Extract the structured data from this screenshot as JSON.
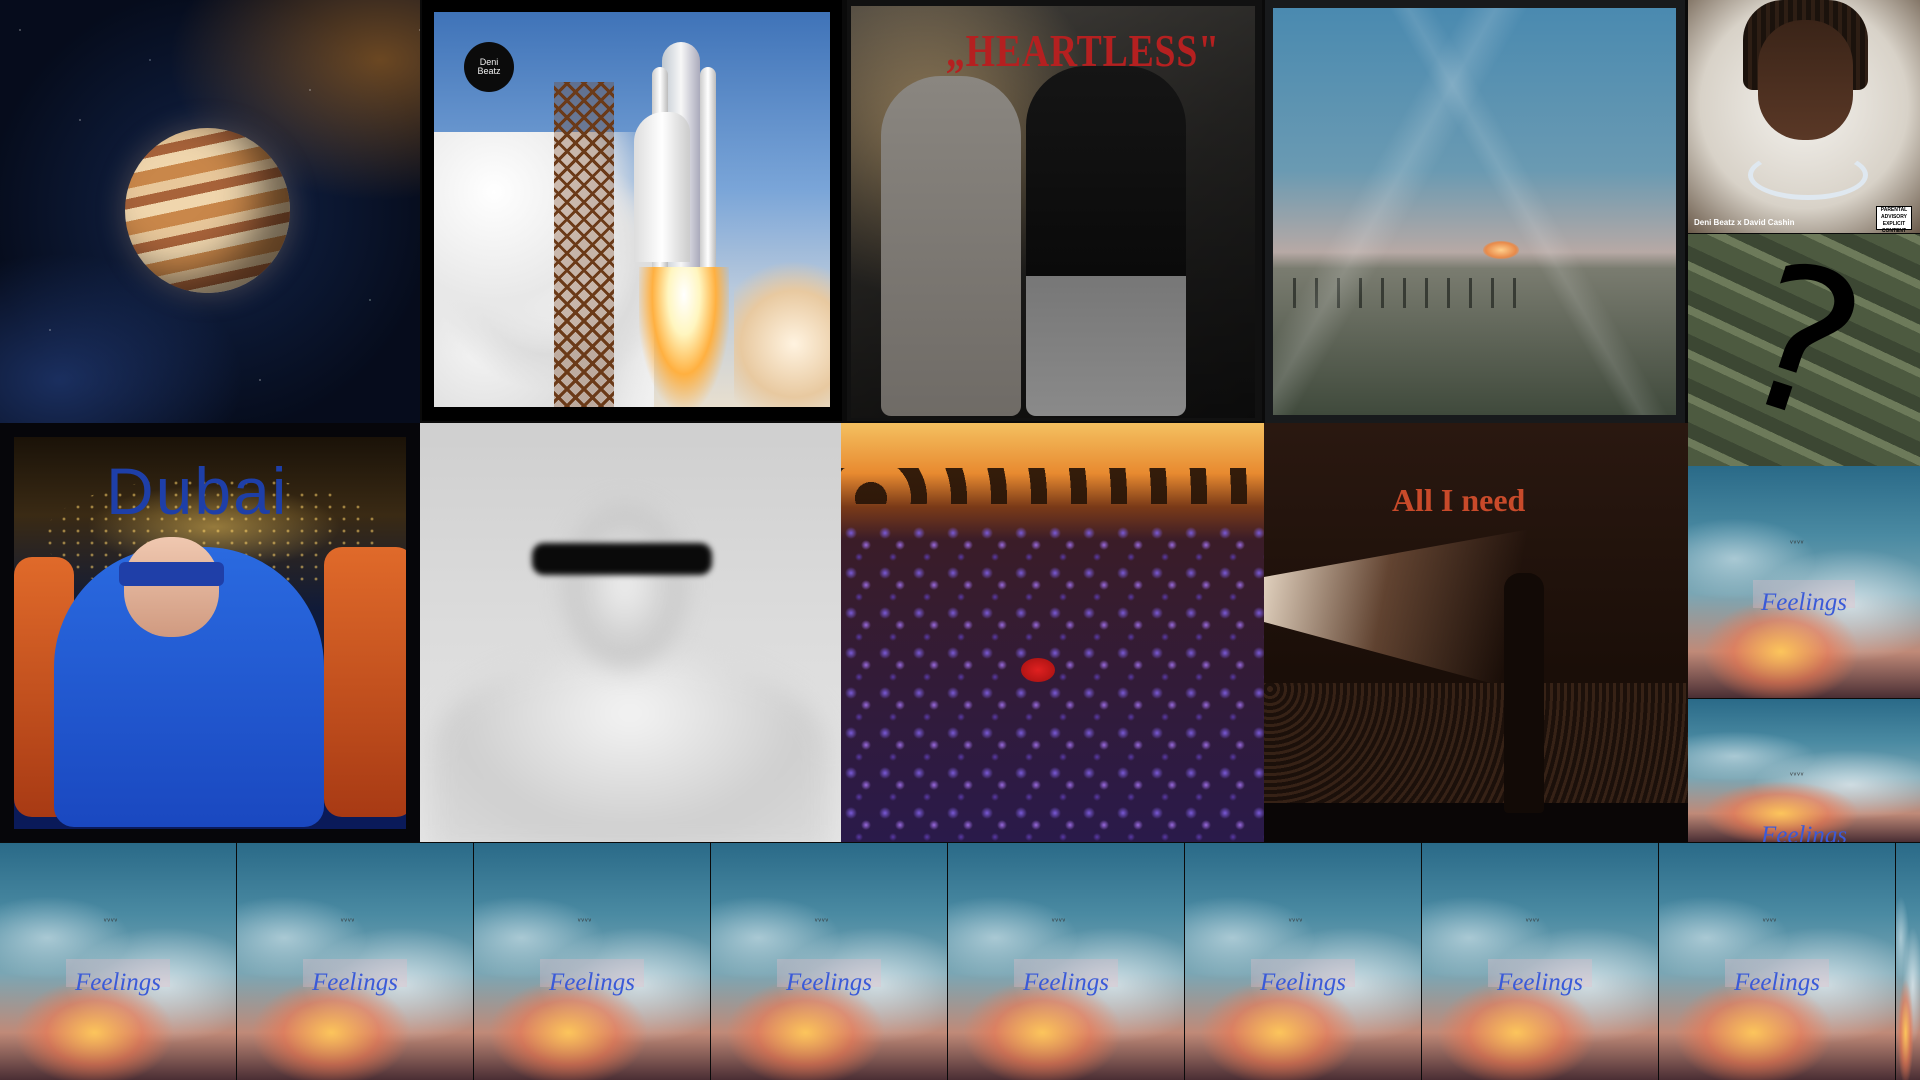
{
  "tiles": {
    "shuttle_badge": "Deni\nBeatz",
    "heartless_title": "„HEARTLESS\"",
    "cashin_credit": "Deni Beatz x David Cashin",
    "advisory": "PARENTAL ADVISORY EXPLICIT CONTENT",
    "question_mark": "?",
    "dubai_title": "Dubai",
    "allneed_title": "All I need",
    "feelings_title": "Feelings",
    "birds": "ᵥᵥᵥᵥ"
  }
}
